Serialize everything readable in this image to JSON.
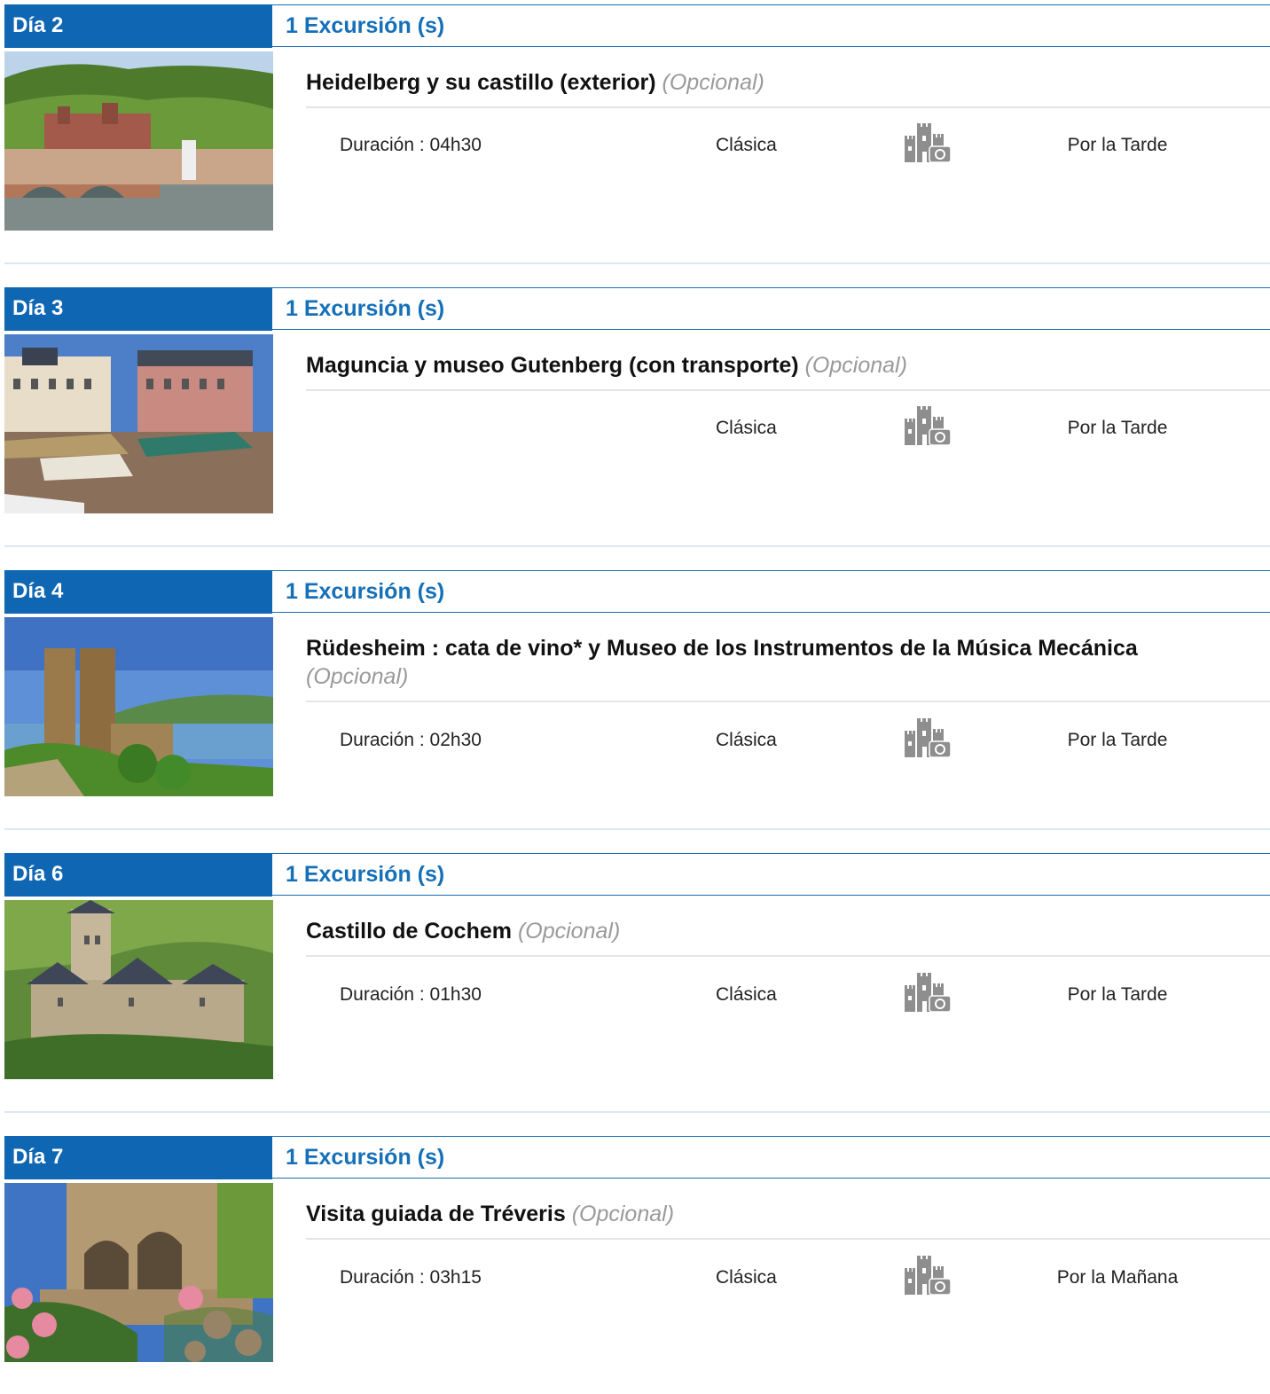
{
  "days": [
    {
      "label": "Día 2",
      "excursions": "1 Excursión (s)",
      "title": "Heidelberg y su castillo (exterior)",
      "optional": "(Opcional)",
      "duration": "Duración : 04h30",
      "style": "Clásica",
      "type_icon": "castle-camera-icon",
      "time": "Por la Tarde"
    },
    {
      "label": "Día 3",
      "excursions": "1 Excursión (s)",
      "title": "Maguncia y museo Gutenberg (con transporte)",
      "optional": "(Opcional)",
      "duration": "",
      "style": "Clásica",
      "type_icon": "castle-camera-icon",
      "time": "Por la Tarde"
    },
    {
      "label": "Día 4",
      "excursions": "1 Excursión (s)",
      "title": "Rüdesheim : cata de vino* y Museo de los Instrumentos de la Música Mecánica",
      "optional": "(Opcional)",
      "duration": "Duración : 02h30",
      "style": "Clásica",
      "type_icon": "castle-camera-icon",
      "time": "Por la Tarde"
    },
    {
      "label": "Día 6",
      "excursions": "1 Excursión (s)",
      "title": "Castillo de Cochem",
      "optional": "(Opcional)",
      "duration": "Duración : 01h30",
      "style": "Clásica",
      "type_icon": "castle-camera-icon",
      "time": "Por la Tarde"
    },
    {
      "label": "Día 7",
      "excursions": "1 Excursión (s)",
      "title": "Visita guiada de Tréveris",
      "optional": "(Opcional)",
      "duration": "Duración : 03h15",
      "style": "Clásica",
      "type_icon": "castle-camera-icon",
      "time": "Por la Mañana"
    }
  ],
  "colors": {
    "header_blue": "#0f66b2",
    "link_blue": "#1570b8",
    "optional_gray": "#9a9a9a"
  }
}
